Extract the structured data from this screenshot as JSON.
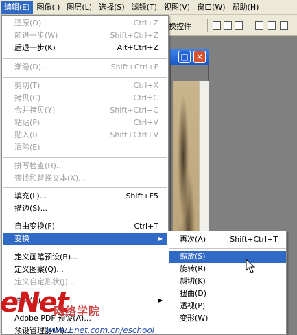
{
  "menubar": {
    "items": [
      {
        "label": "编辑(E)"
      },
      {
        "label": "图像(I)"
      },
      {
        "label": "图层(L)"
      },
      {
        "label": "选择(S)"
      },
      {
        "label": "滤镜(T)"
      },
      {
        "label": "视图(V)"
      },
      {
        "label": "窗口(W)"
      },
      {
        "label": "帮助(H)"
      }
    ]
  },
  "optbar": {
    "label": "换控件"
  },
  "edit_menu": {
    "items": [
      {
        "label": "还原(O)",
        "shortcut": "Ctrl+Z"
      },
      {
        "label": "前进一步(W)",
        "shortcut": "Shift+Ctrl+Z"
      },
      {
        "label": "后退一步(K)",
        "shortcut": "Alt+Ctrl+Z"
      },
      {
        "label": "渐隐(D)...",
        "shortcut": "Shift+Ctrl+F"
      },
      {
        "label": "剪切(T)",
        "shortcut": "Ctrl+X"
      },
      {
        "label": "拷贝(C)",
        "shortcut": "Ctrl+C"
      },
      {
        "label": "合并拷贝(Y)",
        "shortcut": "Shift+Ctrl+C"
      },
      {
        "label": "粘贴(P)",
        "shortcut": "Ctrl+V"
      },
      {
        "label": "贴入(I)",
        "shortcut": "Shift+Ctrl+V"
      },
      {
        "label": "清除(E)",
        "shortcut": ""
      },
      {
        "label": "拼写检查(H)...",
        "shortcut": ""
      },
      {
        "label": "查找和替换文本(X)...",
        "shortcut": ""
      },
      {
        "label": "填充(L)...",
        "shortcut": "Shift+F5"
      },
      {
        "label": "描边(S)...",
        "shortcut": ""
      },
      {
        "label": "自由变换(F)",
        "shortcut": "Ctrl+T"
      },
      {
        "label": "变换",
        "shortcut": ""
      },
      {
        "label": "定义画笔预设(B)...",
        "shortcut": ""
      },
      {
        "label": "定义图案(Q)...",
        "shortcut": ""
      },
      {
        "label": "定义自定形状(J)...",
        "shortcut": ""
      },
      {
        "label": "清理(R)",
        "shortcut": ""
      },
      {
        "label": "Adobe PDF 预设(A)...",
        "shortcut": ""
      },
      {
        "label": "预设管理器(M)...",
        "shortcut": ""
      }
    ]
  },
  "transform_menu": {
    "items": [
      {
        "label": "再次(A)",
        "shortcut": "Shift+Ctrl+T"
      },
      {
        "label": "缩放(S)",
        "shortcut": ""
      },
      {
        "label": "旋转(R)",
        "shortcut": ""
      },
      {
        "label": "斜切(K)",
        "shortcut": ""
      },
      {
        "label": "扭曲(D)",
        "shortcut": ""
      },
      {
        "label": "透视(P)",
        "shortcut": ""
      },
      {
        "label": "变形(W)",
        "shortcut": ""
      }
    ]
  },
  "watermark": {
    "logo": "eNet",
    "cn": "网络学院",
    "url": "www.Enet.com.cn/eschool"
  },
  "colors": {
    "highlight": "#316ac5",
    "disabled": "#a0a0a0"
  }
}
